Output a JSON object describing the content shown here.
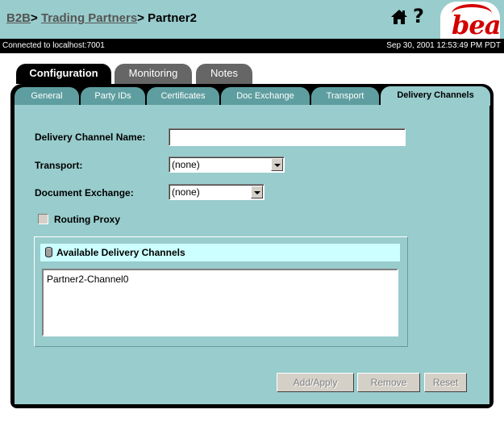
{
  "header": {
    "breadcrumb": [
      "B2B",
      "Trading Partners",
      "Partner2"
    ],
    "sep": ">",
    "logo_text": "bea"
  },
  "status": {
    "connection": "Connected to localhost:7001",
    "timestamp": "Sep 30, 2001 12:53:49 PM PDT"
  },
  "top_tabs": [
    {
      "label": "Configuration",
      "active": true
    },
    {
      "label": "Monitoring",
      "active": false
    },
    {
      "label": "Notes",
      "active": false
    }
  ],
  "sub_tabs": [
    {
      "label": "General",
      "active": false
    },
    {
      "label": "Party IDs",
      "active": false
    },
    {
      "label": "Certificates",
      "active": false
    },
    {
      "label": "Doc Exchange",
      "active": false
    },
    {
      "label": "Transport",
      "active": false
    },
    {
      "label": "Delivery Channels",
      "active": true
    }
  ],
  "form": {
    "name_label": "Delivery Channel Name:",
    "name_value": "",
    "transport_label": "Transport:",
    "transport_value": "(none)",
    "docex_label": "Document Exchange:",
    "docex_value": "(none)",
    "routing_label": "Routing Proxy",
    "routing_checked": false
  },
  "channels": {
    "title": "Available Delivery Channels",
    "items": [
      "Partner2-Channel0"
    ]
  },
  "buttons": {
    "add": "Add/Apply",
    "remove": "Remove",
    "reset": "Reset"
  },
  "colors": {
    "teal": "#99cccc",
    "dark_tab": "#5f9ea0",
    "accent_red": "#d40000"
  }
}
